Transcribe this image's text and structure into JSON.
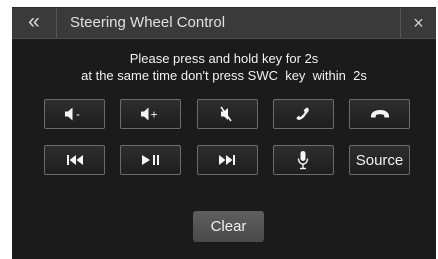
{
  "header": {
    "back_glyph": "«",
    "title": "Steering Wheel Control",
    "close_glyph": "×"
  },
  "instructions": {
    "line1": "Please press and hold key for 2s",
    "line2": "at the same time don't press SWC  key  within  2s"
  },
  "keys": {
    "row1": [
      {
        "icon": "volume-down-icon",
        "label": "-"
      },
      {
        "icon": "volume-up-icon",
        "label": "+"
      },
      {
        "icon": "mute-icon"
      },
      {
        "icon": "phone-answer-icon"
      },
      {
        "icon": "phone-hangup-icon"
      }
    ],
    "row2": [
      {
        "icon": "previous-track-icon"
      },
      {
        "icon": "play-pause-icon"
      },
      {
        "icon": "next-track-icon"
      },
      {
        "icon": "microphone-icon"
      },
      {
        "label": "Source"
      }
    ]
  },
  "clear_label": "Clear",
  "colors": {
    "screen_bg": "#1b1b1b",
    "header_bg": "#3a3a3a",
    "key_border": "#6b6b6b",
    "text": "#f2f2f2",
    "clear_bg": "#555555"
  }
}
